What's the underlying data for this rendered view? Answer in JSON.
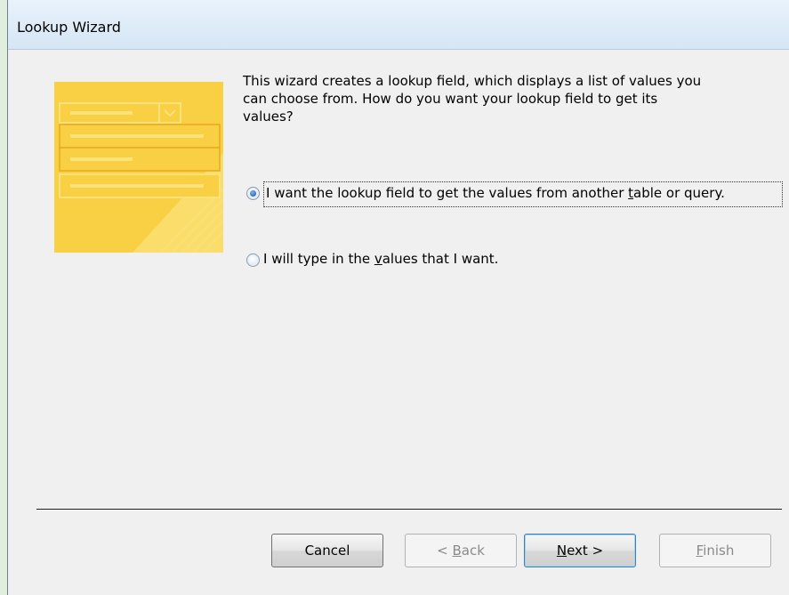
{
  "window": {
    "title": "Lookup Wizard"
  },
  "intro": {
    "text": "This wizard creates a lookup field, which displays a list of values you\ncan choose from.  How do you want your lookup field to get its\nvalues?"
  },
  "options": [
    {
      "before": "I want the lookup field to get the values from another ",
      "mnemonic": "t",
      "after": "able or query.",
      "checked": true
    },
    {
      "before": "I will type in the ",
      "mnemonic": "v",
      "after": "alues that I want.",
      "checked": false
    }
  ],
  "buttons": {
    "cancel": {
      "label": "Cancel"
    },
    "back": {
      "prefix": "< ",
      "mnemonic": "B",
      "rest": "ack",
      "enabled": false
    },
    "next": {
      "mnemonic": "N",
      "rest": "ext >",
      "enabled": true
    },
    "finish": {
      "mnemonic": "F",
      "rest": "inish",
      "enabled": false
    }
  },
  "colors": {
    "illustration_yellow": "#f9cf43",
    "illustration_light": "#fbe27a",
    "illustration_stroke": "#eaa91f"
  }
}
